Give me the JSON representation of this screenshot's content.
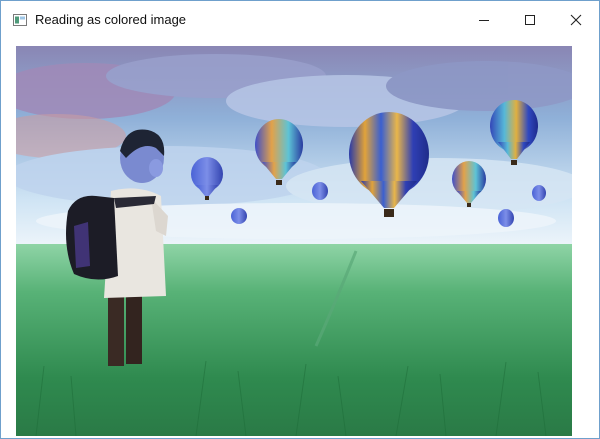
{
  "window": {
    "title": "Reading as colored image",
    "icons": {
      "app": "java-window-icon",
      "minimize": "minimize-icon",
      "maximize": "maximize-icon",
      "close": "close-icon"
    }
  },
  "colors": {
    "window_border": "#6fa0cc",
    "titlebar_bg": "#ffffff",
    "title_text": "#111111",
    "content_bg": "#ffffff"
  },
  "image": {
    "content": "photo-scene",
    "elements": [
      "sky",
      "clouds",
      "hot-air-balloons",
      "grass-field",
      "child-with-backpack"
    ]
  }
}
